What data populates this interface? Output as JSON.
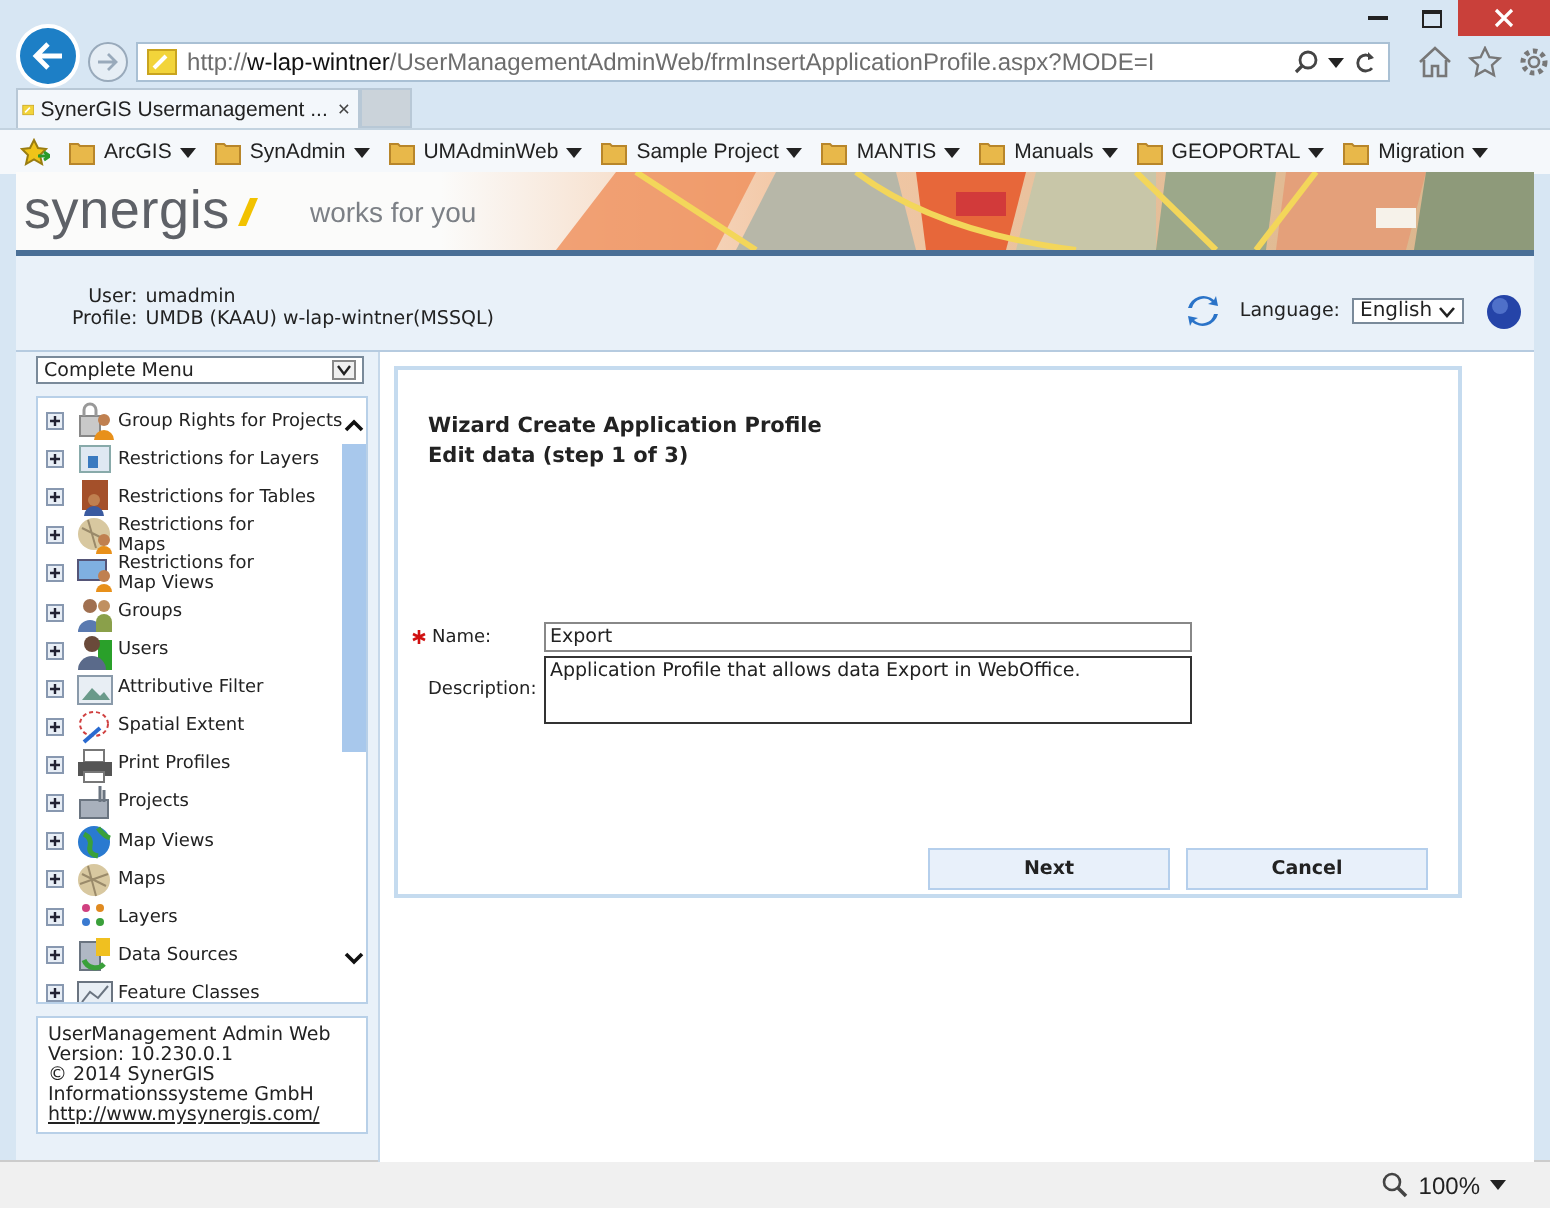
{
  "browser": {
    "address_scheme": "http://",
    "address_host": "w-lap-wintner",
    "address_path": "/UserManagementAdminWeb/frmInsertApplicationProfile.aspx?MODE=I",
    "tabs": [
      {
        "label": "SynerGIS Usermanagement ...",
        "selected": true,
        "close": "×"
      }
    ],
    "favorites": [
      "ArcGIS",
      "SynAdmin",
      "UMAdminWeb",
      "Sample Project",
      "MANTIS",
      "Manuals",
      "GEOPORTAL",
      "Migration"
    ]
  },
  "header": {
    "logo": "synergis",
    "slogan": "works for you"
  },
  "user_info": [
    {
      "label": "User:",
      "value": "umadmin"
    },
    {
      "label": "Profile:",
      "value": "UMDB (KAAU) w-lap-wintner(MSSQL)"
    }
  ],
  "language": {
    "label": "Language:",
    "value": "English"
  },
  "menu": {
    "selector": "Complete Menu",
    "items": [
      {
        "label": "Group Rights for Projects",
        "expanded": false
      },
      {
        "label": "Restrictions for Layers",
        "expanded": false
      },
      {
        "label": "Restrictions for Tables",
        "expanded": false
      },
      {
        "label": "Restrictions for\nMaps",
        "expanded": false
      },
      {
        "label": "Restrictions for\nMap Views",
        "expanded": false
      },
      {
        "label": "Groups",
        "expanded": false
      },
      {
        "label": "Users",
        "expanded": false
      },
      {
        "label": "Attributive Filter",
        "expanded": false
      },
      {
        "label": "Spatial Extent",
        "expanded": false
      },
      {
        "label": "Print Profiles",
        "expanded": false
      },
      {
        "label": "Projects",
        "expanded": false
      },
      {
        "label": "Map Views",
        "expanded": false
      },
      {
        "label": "Maps",
        "expanded": false
      },
      {
        "label": "Layers",
        "expanded": false
      },
      {
        "label": "Data Sources",
        "expanded": false
      },
      {
        "label": "Feature Classes",
        "expanded": false
      }
    ]
  },
  "about": {
    "lines": [
      "UserManagement Admin Web",
      "Version: 10.230.0.1",
      "© 2014 SynerGIS",
      "Informationssysteme GmbH"
    ],
    "link": "http://www.mysynergis.com/"
  },
  "wizard": {
    "title": "Wizard Create Application Profile",
    "subtitle": "Edit data (step 1 of 3)",
    "fields": [
      {
        "kind": "text",
        "label": "Name:",
        "required": true,
        "value": "Export"
      },
      {
        "kind": "textarea",
        "label": "Description:",
        "required": false,
        "value": "Application Profile that allows data Export in WebOffice."
      }
    ],
    "buttons": [
      "Next",
      "Cancel"
    ]
  },
  "status_bar": {
    "zoom": "100%"
  }
}
